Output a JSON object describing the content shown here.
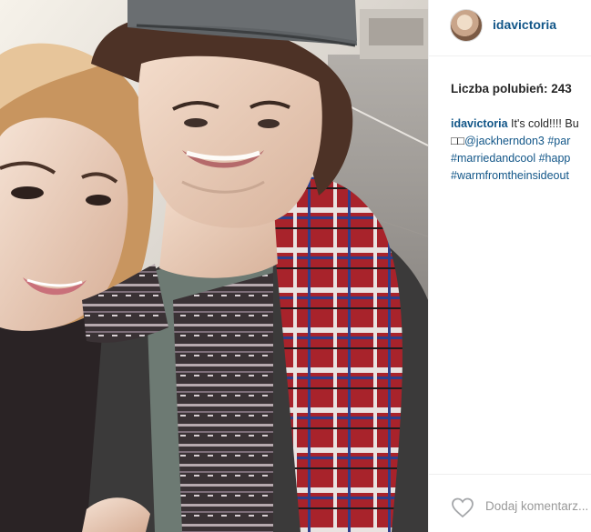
{
  "post": {
    "username": "idavictoria",
    "likes_text": "Liczba polubień: 243",
    "caption": {
      "author": "idavictoria",
      "line1_text": " It's cold!!!! Bu",
      "line2_glyphs": "□□",
      "line2_mention": "@jackherndon3",
      "line2_tag": " #par",
      "line3_tag": "#marriedandcool #happ",
      "line4_tag": "#warmfromtheinsideout"
    },
    "comment_placeholder": "Dodaj komentarz..."
  },
  "icons": {
    "like": "heart-outline-icon"
  },
  "colors": {
    "link": "#125688",
    "text": "#262626",
    "muted": "#999999",
    "divider": "#efefef"
  }
}
